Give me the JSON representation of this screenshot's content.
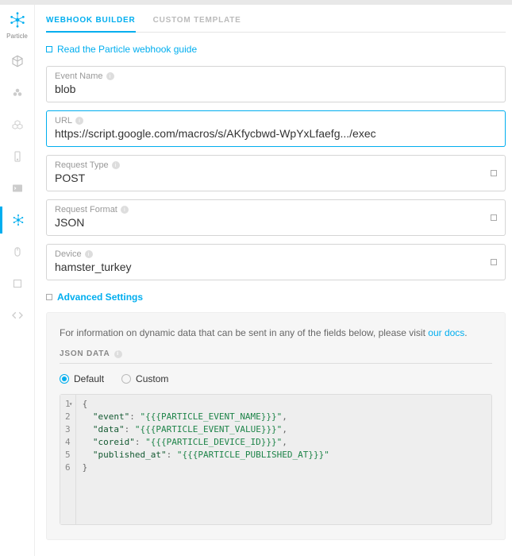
{
  "sidebar": {
    "logo_label": "Particle"
  },
  "tabs": {
    "builder": "WEBHOOK BUILDER",
    "template": "CUSTOM TEMPLATE"
  },
  "guide_link": "Read the Particle webhook guide",
  "fields": {
    "event_name_label": "Event Name",
    "event_name_value": "blob",
    "url_label": "URL",
    "url_value": "https://script.google.com/macros/s/AKfycbwd-WpYxLfaefg.../exec",
    "request_type_label": "Request Type",
    "request_type_value": "POST",
    "request_format_label": "Request Format",
    "request_format_value": "JSON",
    "device_label": "Device",
    "device_value": "hamster_turkey"
  },
  "advanced": {
    "toggle_label": "Advanced Settings",
    "info_prefix": "For information on dynamic data that can be sent in any of the fields below, please visit ",
    "info_link": "our docs",
    "info_suffix": ".",
    "json_data_title": "JSON DATA",
    "radio_default": "Default",
    "radio_custom": "Custom"
  },
  "json_editor": {
    "lines": [
      {
        "n": 1,
        "type": "brace",
        "text": "{"
      },
      {
        "n": 2,
        "type": "kv",
        "key": "event",
        "value": "{{{PARTICLE_EVENT_NAME}}}",
        "comma": true
      },
      {
        "n": 3,
        "type": "kv",
        "key": "data",
        "value": "{{{PARTICLE_EVENT_VALUE}}}",
        "comma": true
      },
      {
        "n": 4,
        "type": "kv",
        "key": "coreid",
        "value": "{{{PARTICLE_DEVICE_ID}}}",
        "comma": true
      },
      {
        "n": 5,
        "type": "kv",
        "key": "published_at",
        "value": "{{{PARTICLE_PUBLISHED_AT}}}",
        "comma": false
      },
      {
        "n": 6,
        "type": "brace",
        "text": "}"
      }
    ]
  }
}
